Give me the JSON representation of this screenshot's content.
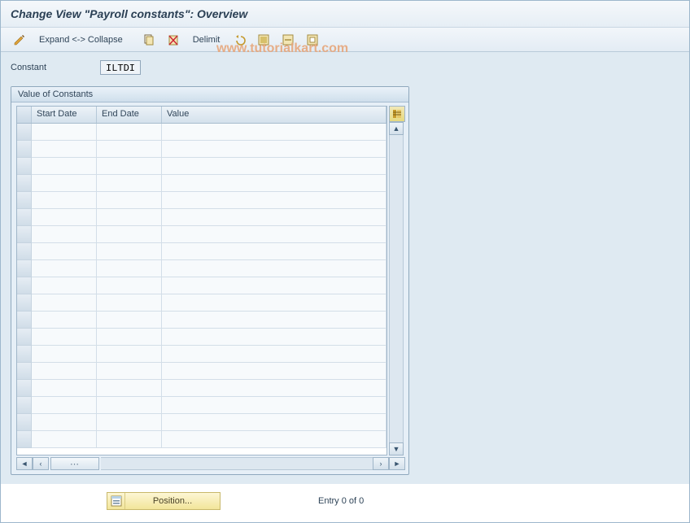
{
  "header": {
    "title": "Change View \"Payroll constants\": Overview"
  },
  "toolbar": {
    "expand_collapse": "Expand <-> Collapse",
    "delimit": "Delimit"
  },
  "filter": {
    "label": "Constant",
    "value": "ILTDI"
  },
  "panel": {
    "title": "Value of Constants",
    "columns": {
      "start_date": "Start Date",
      "end_date": "End Date",
      "value": "Value"
    },
    "rows": []
  },
  "footer": {
    "position_label": "Position...",
    "entry_text": "Entry 0 of 0"
  },
  "watermark": "www.tutorialkart.com"
}
